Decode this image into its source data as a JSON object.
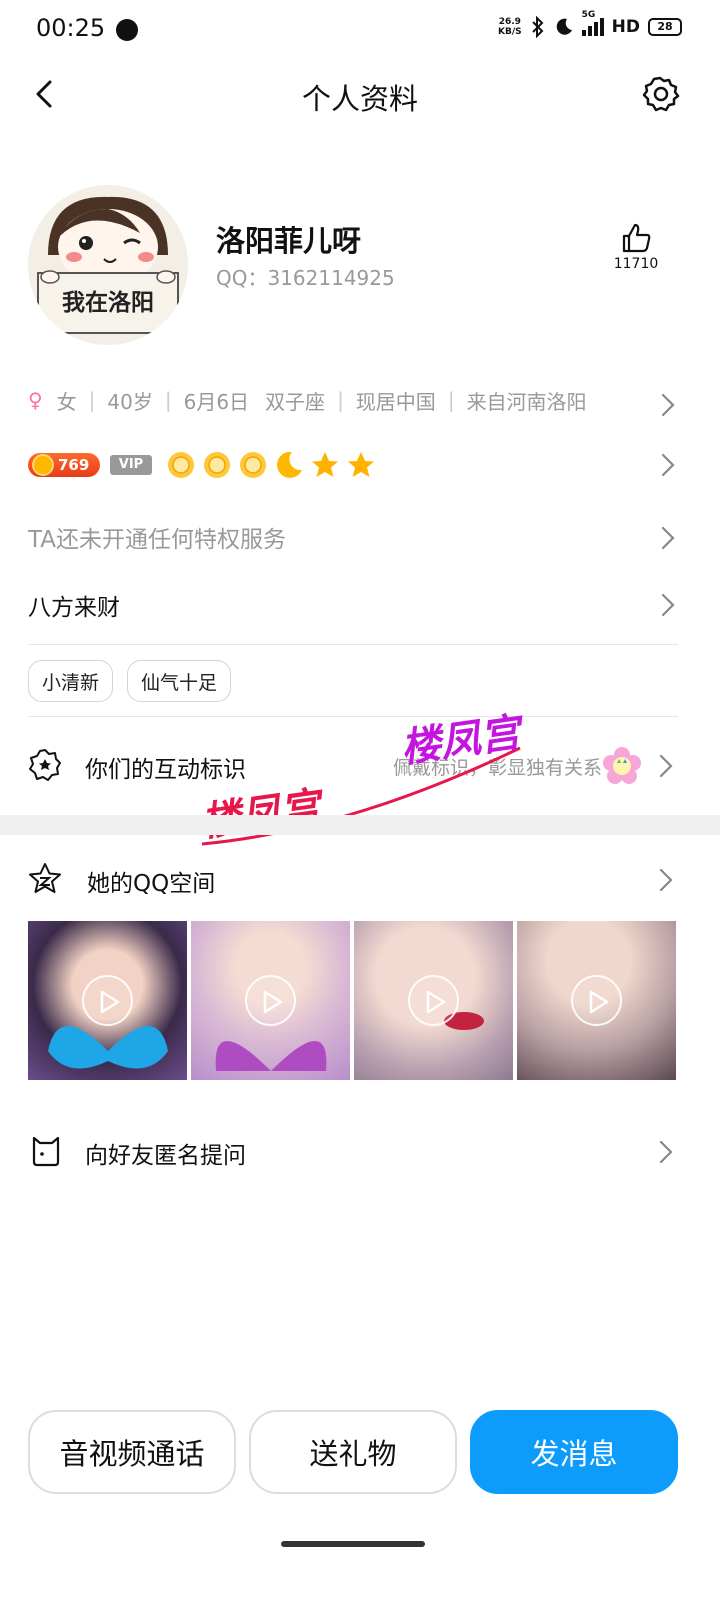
{
  "status_bar": {
    "time": "00:25",
    "net_speed_value": "26.9",
    "net_speed_unit": "KB/S",
    "network_type": "5G",
    "hd": "HD",
    "battery": "28"
  },
  "header": {
    "title": "个人资料",
    "back_icon": "chevron-left-icon",
    "settings_icon": "gear-icon"
  },
  "profile": {
    "avatar_text": "我在洛阳",
    "nickname": "洛阳菲儿呀",
    "qq_label": "QQ：",
    "qq_number": "3162114925",
    "like_count": "11710"
  },
  "info": {
    "gender": "女",
    "age": "40岁",
    "birthday": "6月6日",
    "zodiac": "双子座",
    "residence": "现居中国",
    "hometown": "来自河南洛阳"
  },
  "badges": {
    "level": "769",
    "vip": "VIP",
    "level_icons": [
      "sun-icon",
      "sun-icon",
      "sun-icon",
      "moon-icon",
      "star-icon",
      "star-icon"
    ]
  },
  "privilege_text": "TA还未开通任何特权服务",
  "fortune_text": "八方来财",
  "tags": [
    "小清新",
    "仙气十足"
  ],
  "interaction_mark": {
    "label": "你们的互动标识",
    "hint": "佩戴标识，彰显独有关系"
  },
  "watermark": "楼凤宫",
  "qzone": {
    "label": "她的QQ空间"
  },
  "ask": {
    "label": "向好友匿名提问"
  },
  "bottom": {
    "call_label": "音视频通话",
    "gift_label": "送礼物",
    "message_label": "发消息"
  },
  "colors": {
    "primary": "#0d9cfb",
    "secondary_text": "#999999",
    "female": "#ff6fa8"
  }
}
